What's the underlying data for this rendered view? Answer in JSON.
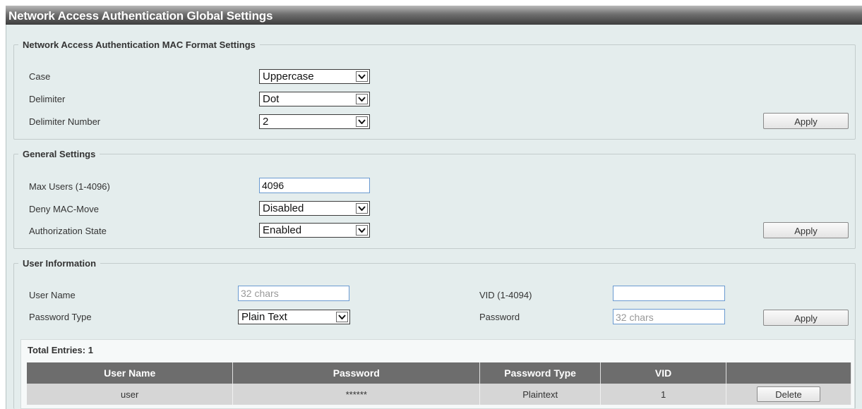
{
  "window": {
    "title": "Network Access Authentication Global Settings"
  },
  "mac_format": {
    "legend": "Network Access Authentication MAC Format Settings",
    "case_label": "Case",
    "case_value": "Uppercase",
    "delimiter_label": "Delimiter",
    "delimiter_value": "Dot",
    "delimiter_number_label": "Delimiter Number",
    "delimiter_number_value": "2",
    "apply_label": "Apply"
  },
  "general": {
    "legend": "General Settings",
    "max_users_label": "Max Users (1-4096)",
    "max_users_value": "4096",
    "deny_mac_move_label": "Deny MAC-Move",
    "deny_mac_move_value": "Disabled",
    "authorization_state_label": "Authorization State",
    "authorization_state_value": "Enabled",
    "apply_label": "Apply"
  },
  "user_info": {
    "legend": "User Information",
    "user_name_label": "User Name",
    "user_name_placeholder": "32 chars",
    "password_type_label": "Password Type",
    "password_type_value": "Plain Text",
    "vid_label": "VID (1-4094)",
    "vid_value": "",
    "password_label": "Password",
    "password_placeholder": "32 chars",
    "apply_label": "Apply"
  },
  "table": {
    "total_entries": "Total Entries: 1",
    "columns": [
      "User Name",
      "Password",
      "Password Type",
      "VID",
      ""
    ],
    "rows": [
      {
        "user_name": "user",
        "password": "******",
        "password_type": "Plaintext",
        "vid": "1",
        "action": "Delete"
      }
    ]
  },
  "colors": {
    "title_bar": "#3d3d3d",
    "panel_bg": "#e4eded",
    "table_header": "#6d6d6d",
    "table_row": "#d6d6d6"
  }
}
